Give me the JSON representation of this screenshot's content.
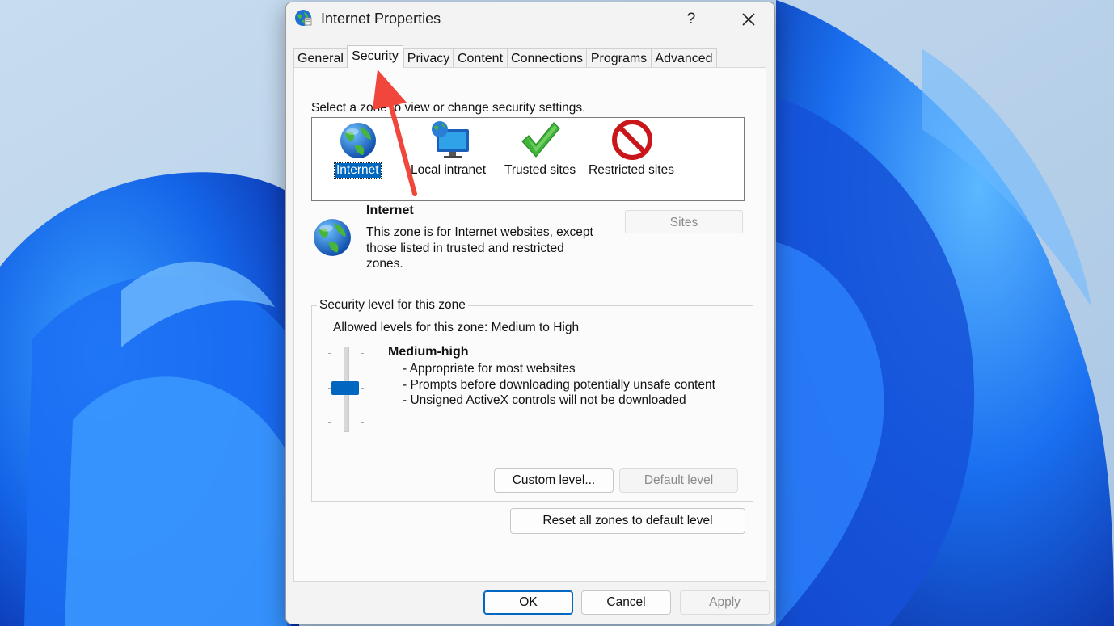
{
  "window": {
    "title": "Internet Properties",
    "help": "?",
    "close": "✕"
  },
  "tabs": [
    {
      "label": "General"
    },
    {
      "label": "Security",
      "active": true
    },
    {
      "label": "Privacy"
    },
    {
      "label": "Content"
    },
    {
      "label": "Connections"
    },
    {
      "label": "Programs"
    },
    {
      "label": "Advanced"
    }
  ],
  "security": {
    "zone_prompt": "Select a zone to view or change security settings.",
    "zones": [
      {
        "label": "Internet",
        "icon": "globe-icon",
        "selected": true
      },
      {
        "label": "Local intranet",
        "icon": "intranet-monitor-icon"
      },
      {
        "label": "Trusted sites",
        "icon": "green-check-icon"
      },
      {
        "label": "Restricted sites",
        "icon": "restricted-icon"
      }
    ],
    "selected_zone": {
      "name": "Internet",
      "description": "This zone is for Internet websites, except those listed in trusted and restricted zones.",
      "sites_button": "Sites"
    },
    "level_group": {
      "title": "Security level for this zone",
      "allowed": "Allowed levels for this zone: Medium to High",
      "level_name": "Medium-high",
      "bullets": [
        "- Appropriate for most websites",
        "- Prompts before downloading potentially unsafe content",
        "- Unsigned ActiveX controls will not be downloaded"
      ],
      "custom_button": "Custom level...",
      "default_button": "Default level"
    },
    "reset_button": "Reset all zones to default level"
  },
  "footer": {
    "ok": "OK",
    "cancel": "Cancel",
    "apply": "Apply"
  },
  "colors": {
    "accent": "#0067c0",
    "annotation_arrow": "#f0463c"
  }
}
